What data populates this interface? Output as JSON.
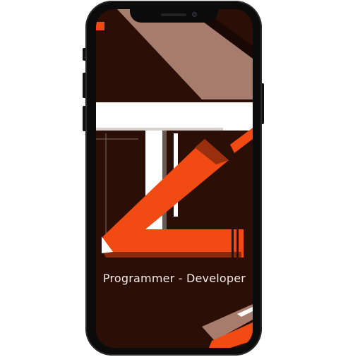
{
  "app": {
    "caption": "Programmer - Developer"
  },
  "device": {
    "frame_color": "#0b0b0b",
    "screen_background": "#2b0f07"
  },
  "wallpaper": {
    "accent_color": "#f14a12",
    "stripe_color": "#a67c6c",
    "white_color": "#ffffff",
    "logo": "TL-monogram-logo"
  }
}
